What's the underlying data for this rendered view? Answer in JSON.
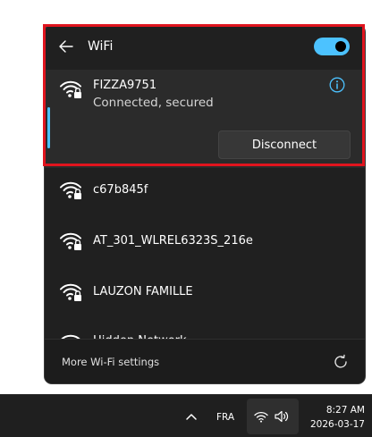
{
  "flyout": {
    "header": {
      "title": "WiFi",
      "back_icon": "back-arrow-icon",
      "wifi_toggle_on": true
    },
    "connected_network": {
      "name": "FIZZA9751",
      "status": "Connected, secured",
      "icon": "wifi-secured-icon",
      "info_icon": "info-icon",
      "disconnect_label": "Disconnect"
    },
    "networks": [
      {
        "name": "c67b845f",
        "icon": "wifi-secured-icon"
      },
      {
        "name": "AT_301_WLREL6323S_216e",
        "icon": "wifi-secured-icon"
      },
      {
        "name": "LAUZON FAMILLE",
        "icon": "wifi-secured-icon"
      },
      {
        "name": "Hidden Network",
        "icon": "wifi-secured-icon"
      }
    ],
    "footer": {
      "more_settings_label": "More Wi-Fi settings",
      "refresh_icon": "refresh-icon"
    }
  },
  "taskbar": {
    "chevron_icon": "chevron-up-icon",
    "language": "FRA",
    "wifi_icon": "wifi-icon",
    "volume_icon": "volume-icon",
    "time": "8:27 AM",
    "date": "2026-03-17"
  },
  "colors": {
    "accent": "#4cc2ff",
    "panel_bg": "#202020",
    "selected_bg": "#2b2b2b",
    "highlight_border": "#e0141e",
    "taskbar_bg": "#1f1f1f"
  }
}
